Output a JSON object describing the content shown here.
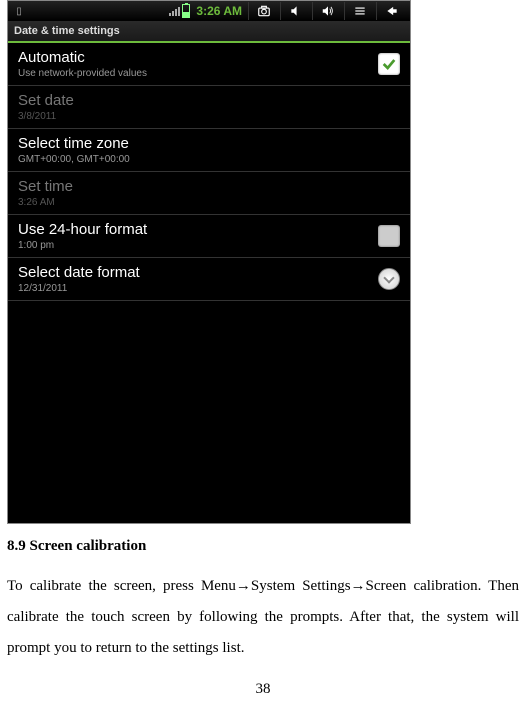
{
  "status": {
    "time": "3:26 AM"
  },
  "titlebar": {
    "label": "Date & time settings"
  },
  "rows": {
    "automatic": {
      "title": "Automatic",
      "sub": "Use network-provided values"
    },
    "setdate": {
      "title": "Set date",
      "sub": "3/8/2011"
    },
    "timezone": {
      "title": "Select time zone",
      "sub": "GMT+00:00, GMT+00:00"
    },
    "settime": {
      "title": "Set time",
      "sub": "3:26 AM"
    },
    "hour24": {
      "title": "Use 24-hour format",
      "sub": "1:00 pm"
    },
    "dateformat": {
      "title": "Select date format",
      "sub": "12/31/2011"
    }
  },
  "doc": {
    "heading": "8.9 Screen calibration",
    "body": "To calibrate the screen, press Menu→System Settings→Screen calibration. Then calibrate the touch screen by following the prompts. After that, the system will prompt you to return to the settings list.",
    "page": "38"
  }
}
